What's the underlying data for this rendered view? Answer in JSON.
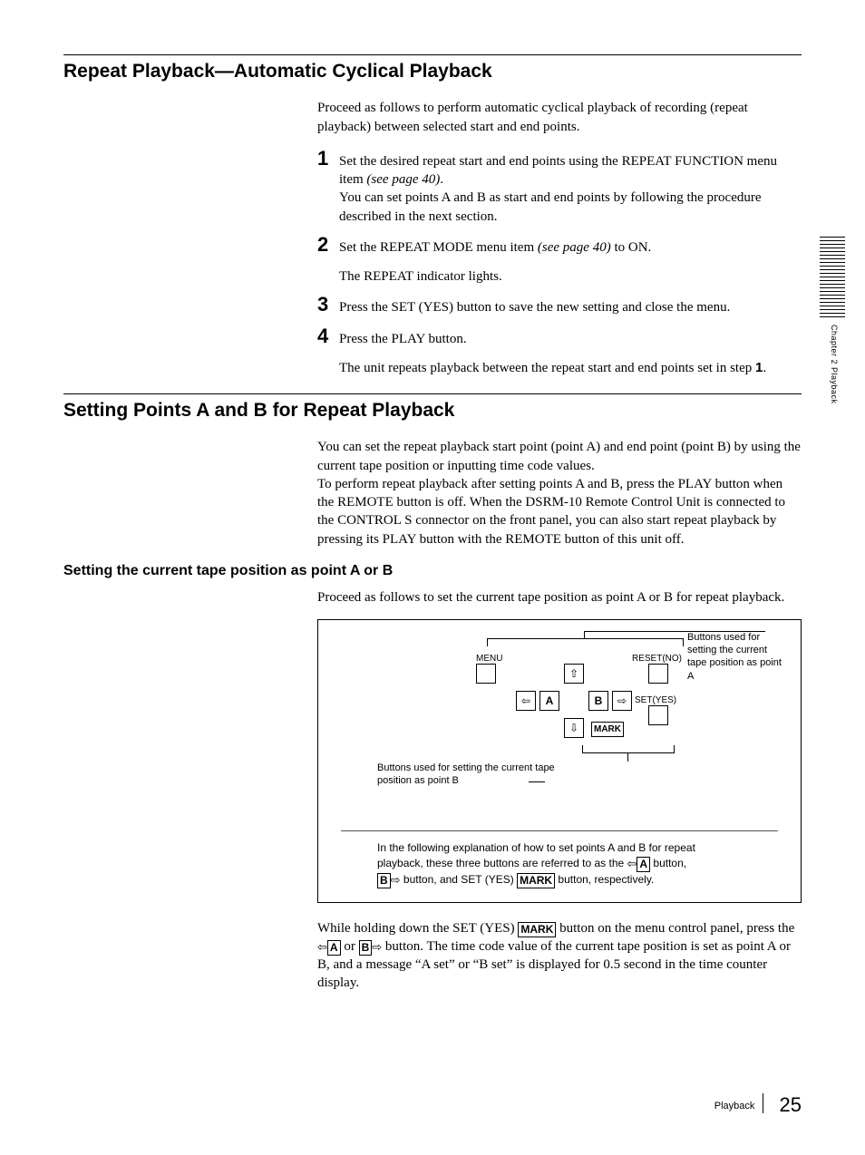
{
  "sidebar": {
    "chapter_label": "Chapter 2  Playback"
  },
  "section1": {
    "title": "Repeat Playback—Automatic Cyclical Playback",
    "intro": "Proceed as follows to perform automatic cyclical playback of recording (repeat playback) between selected start and end points.",
    "steps": [
      {
        "num": "1",
        "text_a": "Set the desired repeat start and end points using the REPEAT FUNCTION menu item ",
        "ref": "(see page 40)",
        "text_b": ".",
        "text_c": "You can set points A and B as start and end points by following the procedure described in the next section."
      },
      {
        "num": "2",
        "text_a": "Set the REPEAT MODE menu item ",
        "ref": "(see page 40)",
        "text_b": " to ON.",
        "sub": "The REPEAT indicator lights."
      },
      {
        "num": "3",
        "text_a": "Press the SET (YES) button to save the new setting and close the menu."
      },
      {
        "num": "4",
        "text_a": "Press the PLAY button.",
        "sub_a": "The unit repeats playback between the repeat start and end points set in step ",
        "sub_b": "1",
        "sub_c": "."
      }
    ]
  },
  "section2": {
    "title": "Setting Points A and B for Repeat Playback",
    "para": "You can set the repeat playback start point (point A) and end point (point B) by using the current tape position or inputting time code values.\nTo perform repeat playback after setting points A and B, press the PLAY button when the REMOTE button is off. When the DSRM-10 Remote Control Unit is connected to the CONTROL S connector on the front panel, you can also start repeat playback by pressing its PLAY button with the REMOTE button of this unit off."
  },
  "section3": {
    "title": "Setting the current tape position as point A or B",
    "intro": "Proceed as follows to set the current tape position as point A or B for repeat playback.",
    "diagram": {
      "labels": {
        "menu": "MENU",
        "reset": "RESET(NO)",
        "set": "SET(YES)",
        "mark": "MARK",
        "a": "A",
        "b": "B"
      },
      "ann_right": "Buttons used for setting the current tape position as point A",
      "ann_left": "Buttons used for setting the current tape position as point B",
      "note_a": "In the following explanation of how to set points A and B for repeat playback, these three buttons are referred to as the ",
      "note_a2": " button, ",
      "note_b": " button, and SET (YES) ",
      "note_c": " button, respectively."
    },
    "closing_a": "While holding down the SET (YES) ",
    "closing_b": " button on the menu control panel, press the ",
    "closing_c": " or ",
    "closing_d": " button. The time code value of the current tape position is set as point A or B, and a message “A set” or “B set” is displayed for 0.5 second in the time counter display."
  },
  "footer": {
    "section": "Playback",
    "page": "25"
  }
}
